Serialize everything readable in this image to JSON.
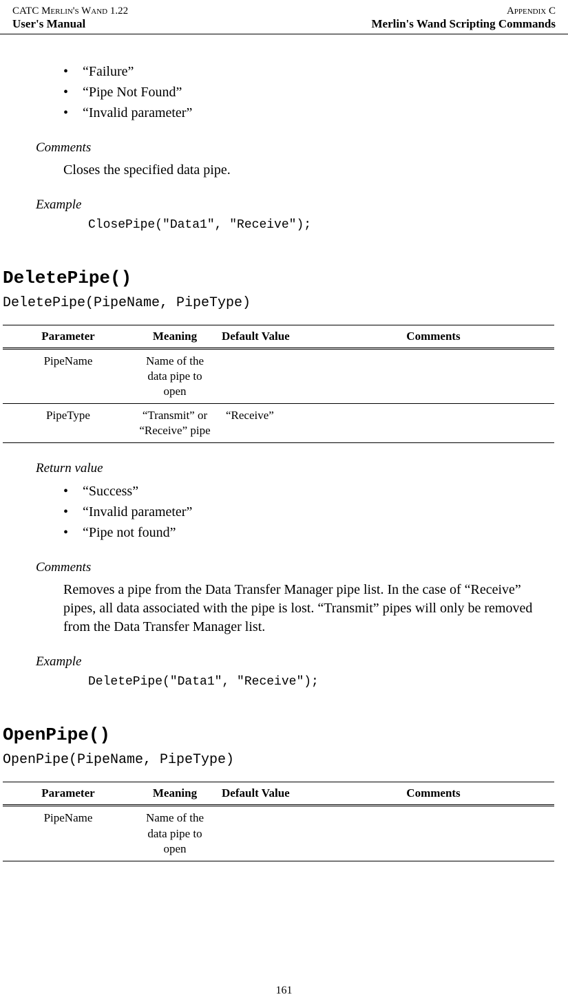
{
  "header": {
    "left_line1": "CATC Merlin's Wand 1.22",
    "left_line2": "User's Manual",
    "right_line1": "Appendix C",
    "right_line2": "Merlin's Wand Scripting Commands"
  },
  "section1": {
    "bullets": [
      "“Failure”",
      "“Pipe Not Found”",
      "“Invalid parameter”"
    ],
    "comments_label": "Comments",
    "comments_text": "Closes the specified data pipe.",
    "example_label": "Example",
    "example_code": "ClosePipe(\"Data1\", \"Receive\");"
  },
  "deletepipe": {
    "name": "DeletePipe()",
    "signature": "DeletePipe(PipeName, PipeType)",
    "headers": [
      "Parameter",
      "Meaning",
      "Default Value",
      "Comments"
    ],
    "rows": [
      {
        "param": "PipeName",
        "meaning": "Name of the data pipe to open",
        "default": "",
        "comments": ""
      },
      {
        "param": "PipeType",
        "meaning": "“Transmit” or “Receive” pipe",
        "default": "“Receive”",
        "comments": ""
      }
    ],
    "return_label": "Return value",
    "returns": [
      "“Success”",
      "“Invalid parameter”",
      "“Pipe not found”"
    ],
    "comments_label": "Comments",
    "comments_text": "Removes a pipe from the Data Transfer Manager pipe list. In the case of “Receive” pipes, all data associated with the pipe is lost. “Transmit” pipes will only be removed from the Data Transfer Manager list.",
    "example_label": "Example",
    "example_code": "DeletePipe(\"Data1\", \"Receive\");"
  },
  "openpipe": {
    "name": "OpenPipe()",
    "signature": "OpenPipe(PipeName, PipeType)",
    "headers": [
      "Parameter",
      "Meaning",
      "Default Value",
      "Comments"
    ],
    "rows": [
      {
        "param": "PipeName",
        "meaning": "Name of the data pipe to open",
        "default": "",
        "comments": ""
      }
    ]
  },
  "page_number": "161"
}
